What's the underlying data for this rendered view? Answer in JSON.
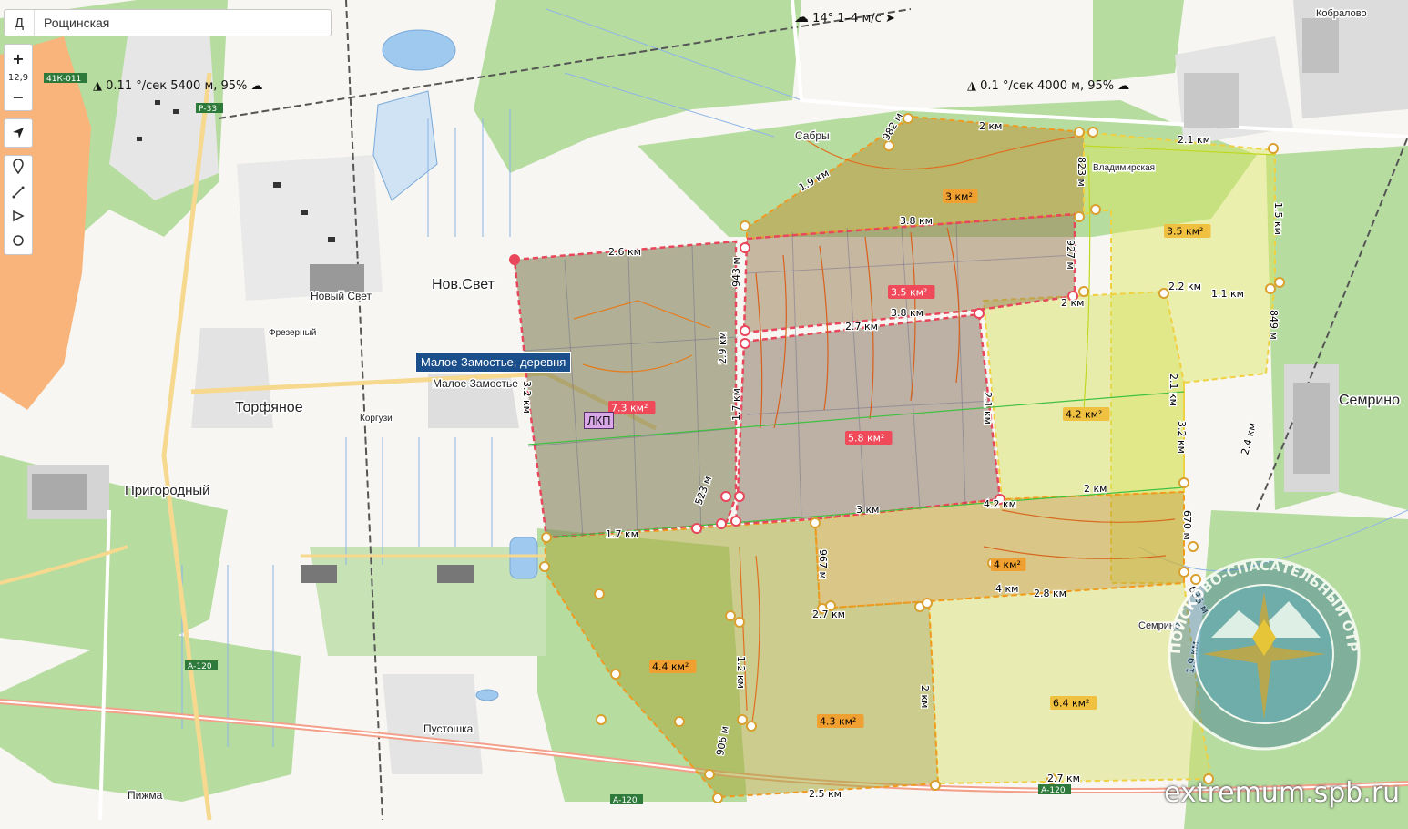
{
  "search": {
    "mode_label": "Д",
    "value": "Рощинская"
  },
  "zoom": {
    "plus": "+",
    "level": "12,9",
    "minus": "−"
  },
  "tools": [
    "navigate-icon",
    "marker-icon",
    "line-icon",
    "polygon-icon",
    "circle-icon"
  ],
  "weather": {
    "top": "14°  1–4 м/с ➤",
    "left_wind": "0.11 °/сек 5400 м, 95%",
    "right_wind": "0.1 °/сек 4000 м, 95%"
  },
  "tooltip": "Малое Замостье, деревня",
  "lkp_label": "ЛКП",
  "watermark": "extremum.spb.ru",
  "logo_text": "ПОИСКОВО-СПАСАТЕЛЬНЫЙ ОТРЯД ЭКСТРЕМУМ",
  "places": [
    {
      "name": "Нов.Свет",
      "size": 16
    },
    {
      "name": "Торфяное",
      "size": 16
    },
    {
      "name": "Пригородный",
      "size": 15
    },
    {
      "name": "Семрино",
      "size": 16
    },
    {
      "name": "Малое Замостье",
      "size": 12
    },
    {
      "name": "Новый Свет",
      "size": 12
    },
    {
      "name": "Пустошка",
      "size": 12
    },
    {
      "name": "Пижма",
      "size": 12
    },
    {
      "name": "Сабры",
      "size": 12
    },
    {
      "name": "Коргузи",
      "size": 10
    },
    {
      "name": "Фрезерный",
      "size": 10
    },
    {
      "name": "Владимирская",
      "size": 10
    },
    {
      "name": "Кобралово",
      "size": 11
    },
    {
      "name": "Семрино",
      "size": 11
    }
  ],
  "distance_labels": [
    "2.6 км",
    "3.2 км",
    "1.7 км",
    "523 м",
    "2.9 км",
    "943 м",
    "1.7 км",
    "1.9 км",
    "982 м",
    "2 км",
    "823 м",
    "2.1 км",
    "3.8 км",
    "927 м",
    "3.8 км",
    "2.7 км",
    "2 км",
    "2.2 км",
    "1.1 км",
    "1.5 км",
    "849 м",
    "2.1 км",
    "2.1 км",
    "3.2 км",
    "3 км",
    "4.2 км",
    "2 км",
    "670 м",
    "967 м",
    "2.7 км",
    "4 км",
    "2.8 км",
    "635 м",
    "1.2 км",
    "906 м",
    "2 км",
    "2.5 км",
    "2.7 км",
    "2.4 км",
    "1.9 км"
  ],
  "zone_area_labels": [
    {
      "text": "3 км²",
      "color": "#f0a030"
    },
    {
      "text": "3.5 км²",
      "color": "#f04a5a"
    },
    {
      "text": "3.5 км²",
      "color": "#f0c040"
    },
    {
      "text": "7.3 км²",
      "color": "#f04a5a"
    },
    {
      "text": "5.8 км²",
      "color": "#f04a5a"
    },
    {
      "text": "4.2 км²",
      "color": "#f0c040"
    },
    {
      "text": "4 км²",
      "color": "#f0a030"
    },
    {
      "text": "4.4 км²",
      "color": "#f0a030"
    },
    {
      "text": "4.3 км²",
      "color": "#f0a030"
    },
    {
      "text": "6.4 км²",
      "color": "#f0c040"
    }
  ],
  "road_labels": [
    "А-120",
    "А-120",
    "А-120",
    "Р-33",
    "41К-011"
  ],
  "colors": {
    "red_zone": "#e8465a",
    "orange_zone": "#f09a20",
    "yellow_zone": "#f0d040",
    "forest": "#b6dca0",
    "water": "#9fc9ee",
    "urban": "#f5a96e"
  }
}
